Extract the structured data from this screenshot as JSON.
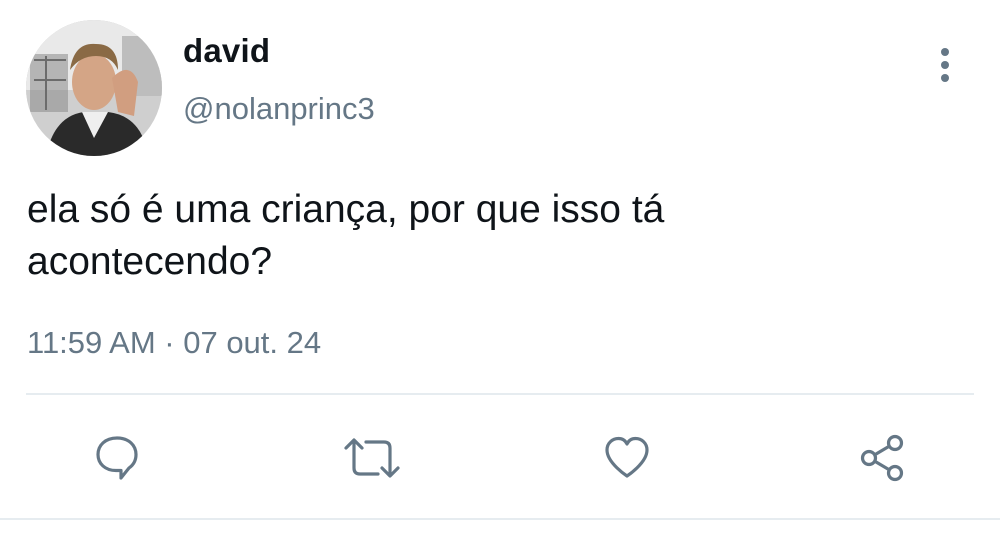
{
  "tweet": {
    "display_name": "david",
    "handle": "@nolanprinc3",
    "text": "ela só é uma criança, por que isso tá\nacontecendo?",
    "timestamp": "11:59 AM · 07 out. 24"
  },
  "icons": {
    "avatar": "profile-photo",
    "more": "vertical-ellipsis-icon",
    "reply": "speech-bubble-icon",
    "retweet": "retweet-arrows-icon",
    "like": "heart-icon",
    "share": "share-nodes-icon"
  },
  "colors": {
    "text": "#0f1419",
    "secondary": "#657786",
    "divider": "#e6ecf0"
  }
}
